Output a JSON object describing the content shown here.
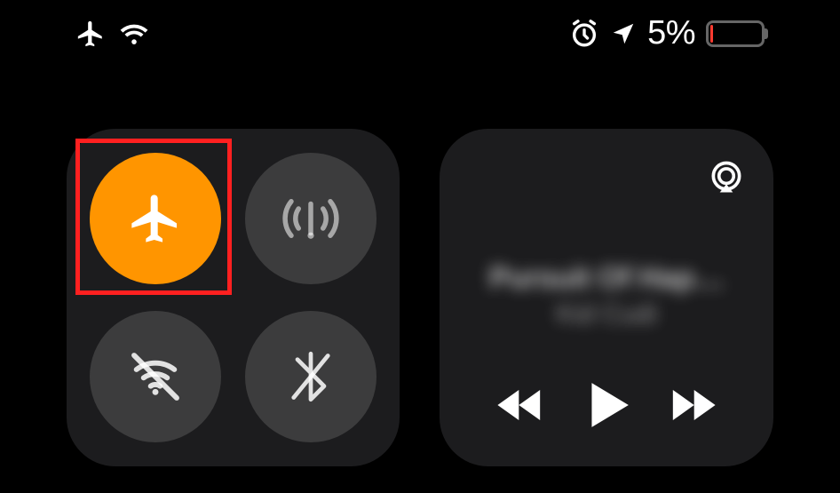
{
  "status_bar": {
    "airplane_mode": true,
    "wifi_connected": true,
    "alarm_set": true,
    "location_active": true,
    "battery_percent_label": "5%",
    "battery_level_pct": 5,
    "battery_low": true
  },
  "connectivity": {
    "airplane": {
      "on": true,
      "color": "#ff9500"
    },
    "cellular": {
      "on": false
    },
    "wifi": {
      "on": false
    },
    "bluetooth": {
      "on": false
    }
  },
  "media": {
    "track_title": "Pursuit Of Hap…",
    "track_artist": "Kid Cudi",
    "playing": false
  },
  "highlight": {
    "target": "airplane-mode-toggle"
  }
}
